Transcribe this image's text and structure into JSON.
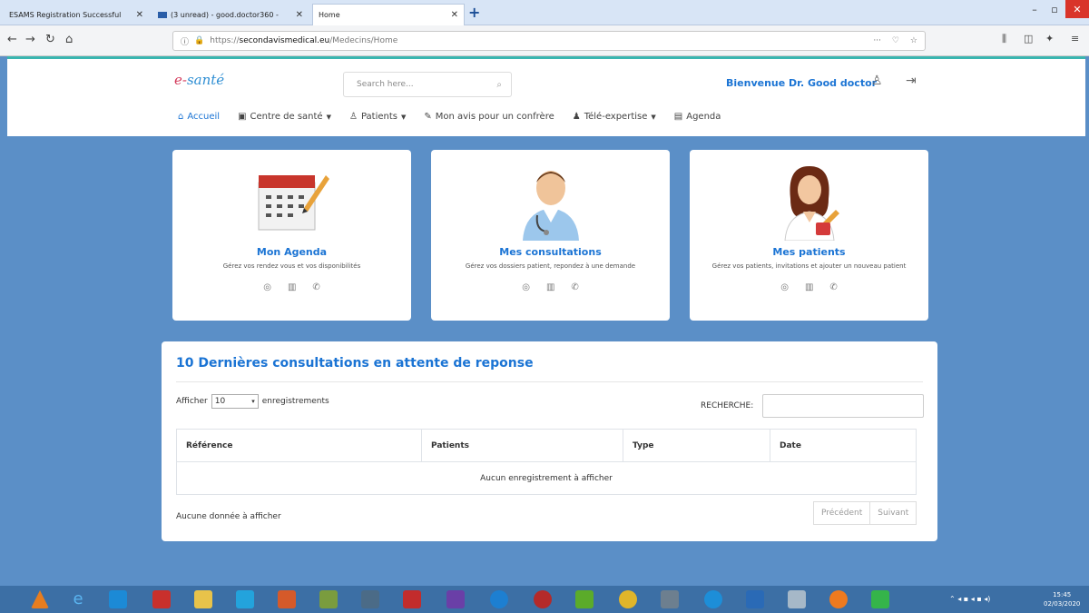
{
  "browser": {
    "tabs": [
      {
        "label": "ESAMS Registration Successful"
      },
      {
        "label": "(3 unread) - good.doctor360 -"
      },
      {
        "label": "Home"
      }
    ],
    "url_prefix": "https://",
    "url_host": "secondavismedical.eu",
    "url_path": "/Medecins/Home"
  },
  "header": {
    "logo_part1": "e-",
    "logo_part2": "santé",
    "search_placeholder": "Search here...",
    "welcome": "Bienvenue Dr. Good doctor"
  },
  "menu": [
    {
      "label": "Accueil",
      "icon": "home-icon"
    },
    {
      "label": "Centre de santé",
      "icon": "building-icon"
    },
    {
      "label": "Patients",
      "icon": "user-icon"
    },
    {
      "label": "Mon avis pour un confrère",
      "icon": "edit-icon"
    },
    {
      "label": "Télé-expertise",
      "icon": "people-icon"
    },
    {
      "label": "Agenda",
      "icon": "calendar-icon"
    }
  ],
  "cards": [
    {
      "title": "Mon Agenda",
      "desc": "Gérez vos rendez vous et vos disponibilités",
      "image": "calendar-image"
    },
    {
      "title": "Mes consultations",
      "desc": "Gérez vos dossiers patient, repondez à une demande",
      "image": "doctor-image"
    },
    {
      "title": "Mes patients",
      "desc": "Gérez vos patients, invitations et ajouter un nouveau patient",
      "image": "female-doctor-image"
    }
  ],
  "panel": {
    "title": "10 Dernières consultations en attente de reponse",
    "show_label": "Afficher",
    "show_value": "10",
    "show_suffix": "enregistrements",
    "search_label": "RECHERCHE:",
    "columns": [
      "Référence",
      "Patients",
      "Type",
      "Date"
    ],
    "empty_row": "Aucun enregistrement à afficher",
    "footer": "Aucune donnée à afficher",
    "prev": "Précédent",
    "next": "Suivant"
  },
  "taskbar": {
    "time": "15:45",
    "date": "02/03/2020"
  },
  "colors": {
    "accent": "#1b74d4",
    "page_bg": "#5b8fc7",
    "header_strip": "#3ab5b0"
  }
}
